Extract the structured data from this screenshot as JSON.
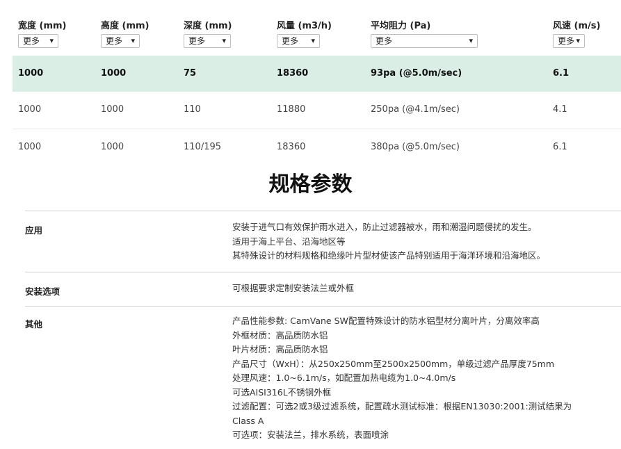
{
  "columns": [
    {
      "label": "宽度 (mm)",
      "filter": "更多"
    },
    {
      "label": "高度 (mm)",
      "filter": "更多"
    },
    {
      "label": "深度 (mm)",
      "filter": "更多"
    },
    {
      "label": "风量 (m3/h)",
      "filter": "更多"
    },
    {
      "label": "平均阻力 (Pa)",
      "filter": "更多"
    },
    {
      "label": "风速 (m/s)",
      "filter": "更多"
    }
  ],
  "rows": [
    [
      "1000",
      "1000",
      "75",
      "18360",
      "93pa (@5.0m/sec)",
      "6.1"
    ],
    [
      "1000",
      "1000",
      "110",
      "11880",
      "250pa (@4.1m/sec)",
      "4.1"
    ],
    [
      "1000",
      "1000",
      "110/195",
      "18360",
      "380pa (@5.0m/sec)",
      "6.1"
    ]
  ],
  "spec": {
    "title": "规格参数",
    "items": [
      {
        "label": "应用",
        "lines": [
          "安装于进气口有效保护雨水进入，防止过滤器被水，雨和潮湿问题侵扰的发生。",
          "适用于海上平台、沿海地区等",
          "其特殊设计的材料规格和绝缘叶片型材使该产品特别适用于海洋环境和沿海地区。"
        ]
      },
      {
        "label": "安装选项",
        "lines": [
          "可根据要求定制安装法兰或外框"
        ]
      },
      {
        "label": "其他",
        "lines": [
          "产品性能参数: CamVane SW配置特殊设计的防水铝型材分离叶片，分离效率高",
          "外框材质：高品质防水铝",
          "叶片材质：高品质防水铝",
          "产品尺寸（WxH）：从250x250mm至2500x2500mm，单级过滤产品厚度75mm",
          "处理风速：1.0~6.1m/s，如配置加热电缆为1.0~4.0m/s",
          "可选AISI316L不锈钢外框",
          "过滤配置：可选2或3级过滤系统，配置疏水测试标准：根据EN13030:2001:测试结果为",
          "Class A",
          "可选项：安装法兰，排水系统，表面喷涂"
        ]
      }
    ]
  }
}
